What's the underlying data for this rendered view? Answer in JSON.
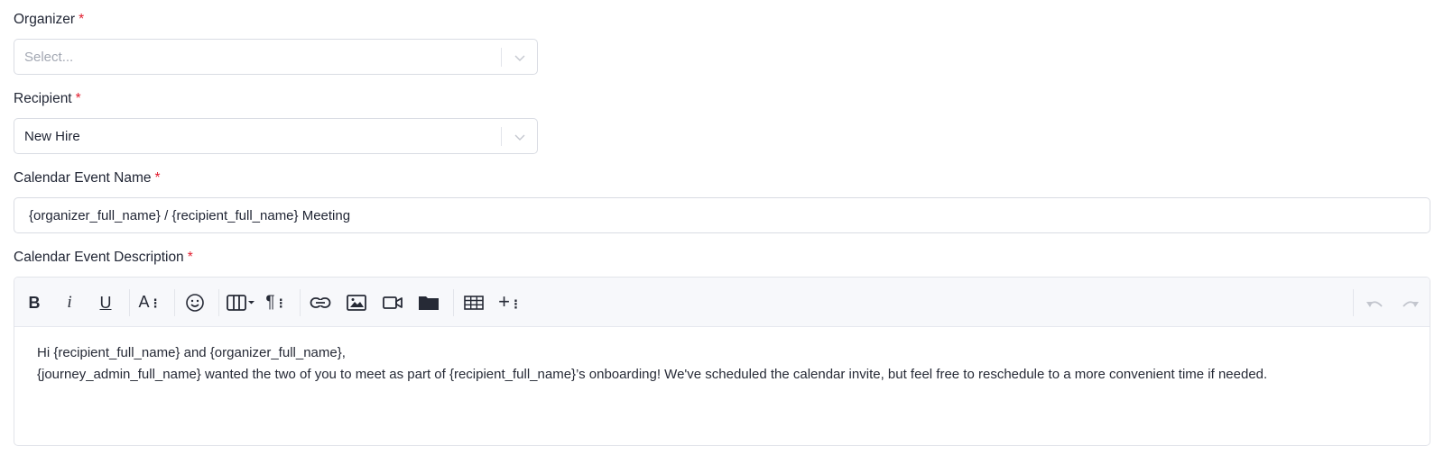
{
  "form": {
    "required_marker": "*",
    "organizer": {
      "label": "Organizer",
      "placeholder": "Select..."
    },
    "recipient": {
      "label": "Recipient",
      "value": "New Hire"
    },
    "event_name": {
      "label": "Calendar Event Name",
      "value": "{organizer_full_name} / {recipient_full_name} Meeting"
    },
    "event_description": {
      "label": "Calendar Event Description",
      "lines": [
        "Hi {recipient_full_name} and {organizer_full_name},",
        "{journey_admin_full_name} wanted the two of you to meet as part of {recipient_full_name}’s onboarding! We've scheduled the calendar invite, but feel free to reschedule to a more convenient time if needed."
      ]
    }
  },
  "toolbar": {
    "bold": "B",
    "italic": "i",
    "underline": "U",
    "font_size": "A",
    "icons": [
      "bold-icon",
      "italic-icon",
      "underline-icon",
      "font-size-icon",
      "emoji-icon",
      "table-columns-icon",
      "paragraph-icon",
      "link-icon",
      "image-icon",
      "video-icon",
      "folder-icon",
      "table-icon",
      "insert-more-icon",
      "undo-icon",
      "redo-icon"
    ]
  }
}
